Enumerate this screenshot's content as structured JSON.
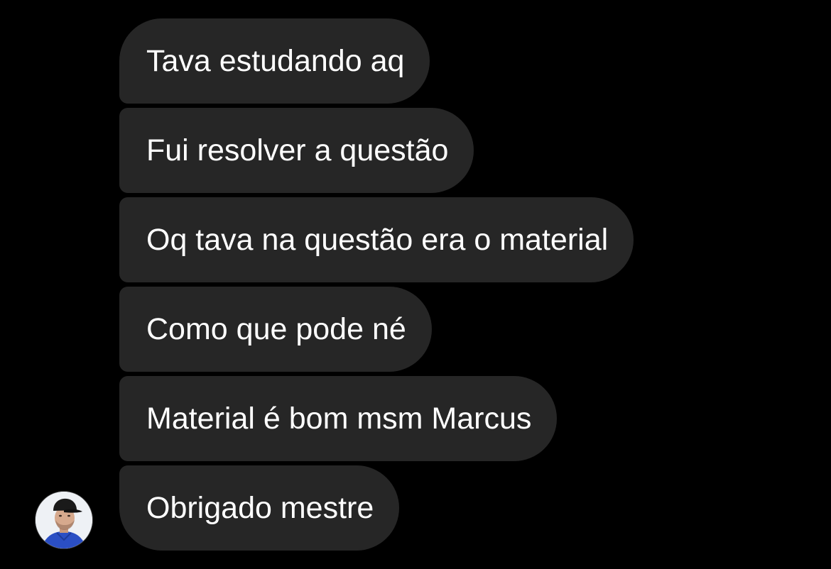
{
  "messages": [
    {
      "text": "Tava estudando aq"
    },
    {
      "text": "Fui resolver a questão"
    },
    {
      "text": "Oq tava na questão era o material"
    },
    {
      "text": "Como que pode né"
    },
    {
      "text": "Material é bom msm Marcus"
    },
    {
      "text": "Obrigado mestre"
    }
  ],
  "sender": {
    "avatar_icon": "profile-photo-avatar"
  },
  "colors": {
    "background": "#000000",
    "bubble": "#262626",
    "text": "#ffffff"
  }
}
